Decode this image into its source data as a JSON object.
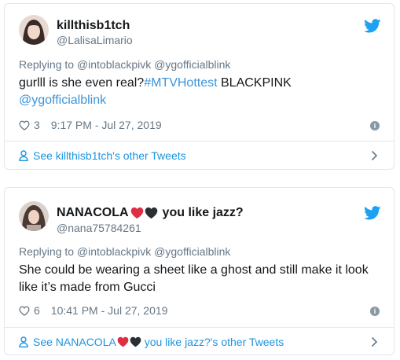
{
  "tweets": [
    {
      "display_name": "killthisb1tch",
      "handle": "@LalisaLimario",
      "replying": "Replying to @intoblackpivk @ygofficialblink",
      "text_plain": "gurlll is she even real?",
      "hashtag": "#MTVHottest",
      "text_after_tag": " BLACKPINK",
      "mention": "@ygofficialblink",
      "likes": "3",
      "timestamp": "9:17 PM - Jul 27, 2019",
      "footer_link": "See killthisb1tch's other Tweets"
    },
    {
      "display_name_pre": "NANACOLA",
      "display_name_post": "you like jazz?",
      "handle": "@nana75784261",
      "replying": "Replying to @intoblackpivk @ygofficialblink",
      "text_line1": "She could be wearing a sheet like a ghost and still make it look",
      "text_line2": "like it’s made from Gucci",
      "likes": "6",
      "timestamp": "10:41 PM - Jul 27, 2019",
      "footer_pre": "See NANACOLA",
      "footer_post": " you like jazz?'s other Tweets"
    }
  ],
  "icons": {
    "brand": "twitter-bird-icon",
    "like": "heart-icon",
    "info": "info-icon",
    "profile": "person-icon",
    "chevron": "chevron-right-icon"
  },
  "colors": {
    "link": "#1b95e0",
    "muted": "#657786",
    "border": "#e1e8ed",
    "brand": "#1da1f2",
    "red_heart": "#dd2e44",
    "black_heart": "#292f33"
  }
}
